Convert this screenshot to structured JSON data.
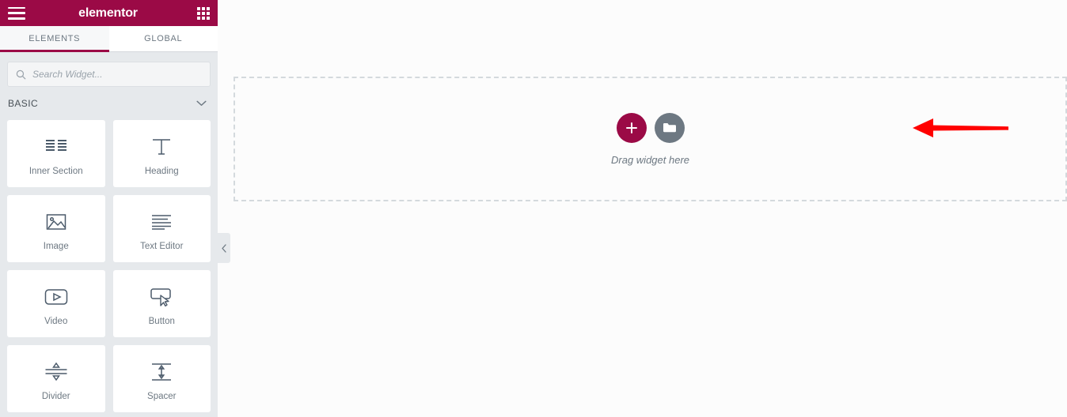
{
  "panel": {
    "header": {
      "brand": "elementor",
      "menu_icon": "hamburger-icon",
      "apps_icon": "apps-grid-icon"
    },
    "tabs": [
      {
        "label": "ELEMENTS",
        "active": true
      },
      {
        "label": "GLOBAL",
        "active": false
      }
    ],
    "search": {
      "placeholder": "Search Widget...",
      "value": "",
      "icon": "search-icon"
    },
    "category": {
      "label": "BASIC",
      "chevron_icon": "chevron-down-icon",
      "expanded": true
    },
    "widgets": [
      {
        "label": "Inner Section",
        "icon": "inner-section-icon"
      },
      {
        "label": "Heading",
        "icon": "heading-icon"
      },
      {
        "label": "Image",
        "icon": "image-icon"
      },
      {
        "label": "Text Editor",
        "icon": "text-editor-icon"
      },
      {
        "label": "Video",
        "icon": "video-icon"
      },
      {
        "label": "Button",
        "icon": "button-icon"
      },
      {
        "label": "Divider",
        "icon": "divider-icon"
      },
      {
        "label": "Spacer",
        "icon": "spacer-icon"
      }
    ],
    "collapse_handle_icon": "chevron-left-icon"
  },
  "canvas": {
    "drop_zone": {
      "text": "Drag widget here",
      "add_button_icon": "plus-icon",
      "folder_button_icon": "folder-icon"
    },
    "annotation": {
      "type": "arrow",
      "direction": "left",
      "color": "#ff0000"
    }
  },
  "colors": {
    "brand": "#9b0a46",
    "panel_bg": "#e6e9ec",
    "card_bg": "#ffffff",
    "text_muted": "#6d7882",
    "canvas_bg": "#fcfcfc",
    "dashed_border": "#d4d9dd",
    "annotation": "#ff0000"
  }
}
